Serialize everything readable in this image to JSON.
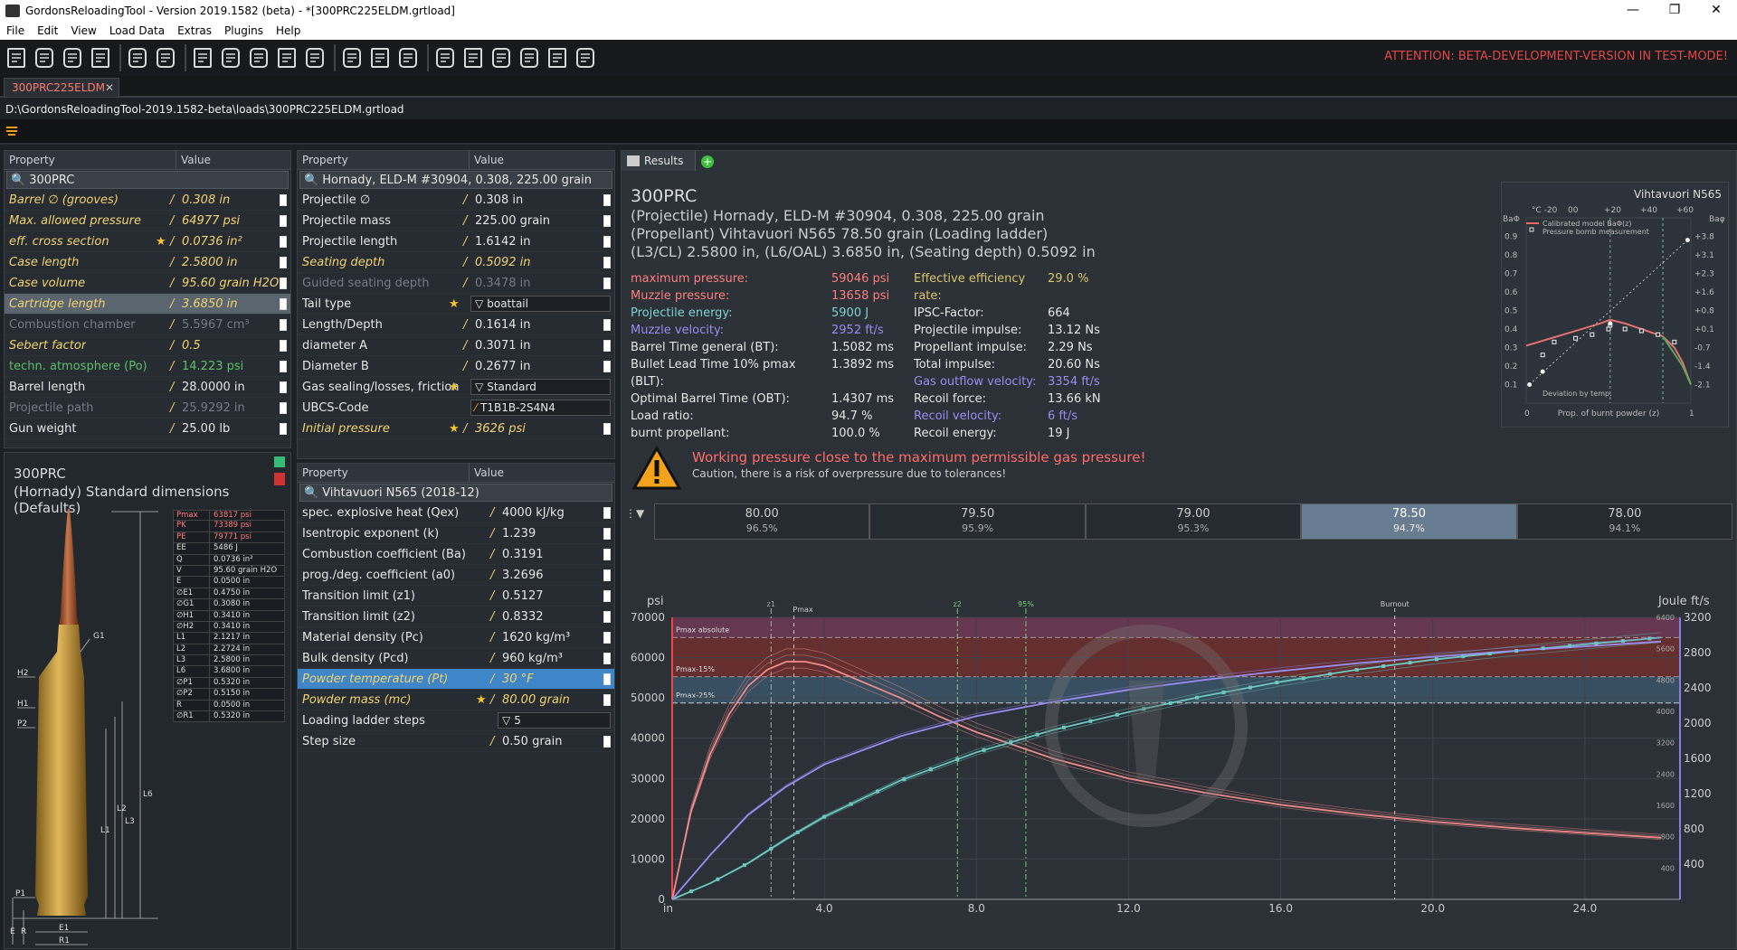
{
  "window": {
    "title": "GordonsReloadingTool - Version 2019.1582 (beta) - *[300PRC225ELDM.grtload]",
    "min": "—",
    "max": "❐",
    "close": "✕"
  },
  "menu": [
    "File",
    "Edit",
    "View",
    "Load Data",
    "Extras",
    "Plugins",
    "Help"
  ],
  "toolbar": {
    "attention": "ATTENTION: BETA-DEVELOPMENT-VERSION IN TEST-MODE!"
  },
  "tab": {
    "name": "300PRC225ELDM",
    "close": "✕"
  },
  "path": "D:\\GordonsReloadingTool-2019.1582-beta\\loads\\300PRC225ELDM.grtload",
  "colors": {
    "accent": "#f1d26e",
    "danger": "#ff6b6b",
    "selected": "#3f86c8"
  },
  "cartridge": {
    "header": [
      "Property",
      "Value"
    ],
    "title": "300PRC",
    "rows": [
      {
        "label": "Barrel ∅ (grooves)",
        "value": "0.308 in",
        "style": "it"
      },
      {
        "label": "Max. allowed pressure",
        "value": "64977 psi",
        "style": "it"
      },
      {
        "label": "eff. cross section",
        "value": "0.0736 in²",
        "style": "it",
        "star": true
      },
      {
        "label": "Case length",
        "value": "2.5800 in",
        "style": "it"
      },
      {
        "label": "Case volume",
        "value": "95.60 grain H2O",
        "style": "it"
      },
      {
        "label": "Cartridge length",
        "value": "3.6850 in",
        "style": "it",
        "sel": true
      },
      {
        "label": "Combustion chamber",
        "value": "5.5967 cm³",
        "style": "dim"
      },
      {
        "label": "Sebert factor",
        "value": "0.5",
        "style": "it"
      },
      {
        "label": "techn. atmosphere (Po)",
        "value": "14.223 psi",
        "style": "grn"
      },
      {
        "label": "Barrel length",
        "value": "28.0000 in",
        "style": ""
      },
      {
        "label": "Projectile path",
        "value": "25.9292 in",
        "style": "dim"
      },
      {
        "label": "Gun weight",
        "value": "25.00 lb",
        "style": ""
      }
    ]
  },
  "dims": {
    "title": "300PRC",
    "subtitle": "(Hornady) Standard dimensions (Defaults)",
    "table": [
      [
        "Pmax",
        "63817 psi"
      ],
      [
        "PK",
        "73389 psi"
      ],
      [
        "PE",
        "79771 psi"
      ],
      [
        "EE",
        "5486 J"
      ],
      [
        "Q",
        "0.0736 in²"
      ],
      [
        "V",
        "95.60 grain H2O"
      ],
      [
        "E",
        "0.0500 in"
      ],
      [
        "∅E1",
        "0.4750 in"
      ],
      [
        "∅G1",
        "0.3080 in"
      ],
      [
        "∅H1",
        "0.3410 in"
      ],
      [
        "∅H2",
        "0.3410 in"
      ],
      [
        "L1",
        "2.1217 in"
      ],
      [
        "L2",
        "2.2724 in"
      ],
      [
        "L3",
        "2.5800 in"
      ],
      [
        "L6",
        "3.6800 in"
      ],
      [
        "∅P1",
        "0.5320 in"
      ],
      [
        "∅P2",
        "0.5150 in"
      ],
      [
        "R",
        "0.0500 in"
      ],
      [
        "∅R1",
        "0.5320 in"
      ]
    ],
    "labels": {
      "g1": "G1",
      "h2": "H2",
      "h1": "H1",
      "p2": "P2",
      "p1": "P1",
      "l6": "L6",
      "l3": "L3",
      "l2": "L2",
      "l1": "L1",
      "e1": "E1",
      "r1": "R1",
      "e": "E",
      "r": "R"
    }
  },
  "projectile": {
    "header": [
      "Property",
      "Value"
    ],
    "title": "Hornady, ELD-M #30904, 0.308, 225.00 grain",
    "rows": [
      {
        "label": "Projectile ∅",
        "value": "0.308 in",
        "style": ""
      },
      {
        "label": "Projectile mass",
        "value": "225.00 grain",
        "style": ""
      },
      {
        "label": "Projectile length",
        "value": "1.6142 in",
        "style": ""
      },
      {
        "label": "Seating depth",
        "value": "0.5092 in",
        "style": "it"
      },
      {
        "label": "Guided seating depth",
        "value": "0.3478 in",
        "style": "dim"
      },
      {
        "label": "Tail type",
        "value": "boattail",
        "style": "",
        "dd": true,
        "star": true
      },
      {
        "label": "Length/Depth",
        "value": "0.1614 in",
        "style": ""
      },
      {
        "label": "diameter A",
        "value": "0.3071 in",
        "style": ""
      },
      {
        "label": "Diameter B",
        "value": "0.2677 in",
        "style": ""
      },
      {
        "label": "Gas sealing/losses, friction",
        "value": "Standard",
        "style": "",
        "dd": true,
        "star": true
      },
      {
        "label": "UBCS-Code",
        "value": "T1B1B-2S4N4",
        "style": "",
        "code": true
      },
      {
        "label": "Initial pressure",
        "value": "3626 psi",
        "style": "it",
        "star": true
      }
    ]
  },
  "propellant": {
    "header": [
      "Property",
      "Value"
    ],
    "title": "Vihtavuori N565 (2018-12)",
    "rows": [
      {
        "label": "spec. explosive heat (Qex)",
        "value": "4000 kJ/kg",
        "style": ""
      },
      {
        "label": "Isentropic exponent (k)",
        "value": "1.239",
        "style": ""
      },
      {
        "label": "Combustion coefficient (Ba)",
        "value": "0.3191",
        "style": ""
      },
      {
        "label": "prog./deg. coefficient (a0)",
        "value": "3.2696",
        "style": ""
      },
      {
        "label": "Transition limit (z1)",
        "value": "0.5127",
        "style": ""
      },
      {
        "label": "Transition limit (z2)",
        "value": "0.8332",
        "style": ""
      },
      {
        "label": "Material density (Pc)",
        "value": "1620 kg/m³",
        "style": ""
      },
      {
        "label": "Bulk density (Pcd)",
        "value": "960 kg/m³",
        "style": ""
      },
      {
        "label": "Powder temperature (Pt)",
        "value": "30 °F",
        "style": "it",
        "selblue": true
      },
      {
        "label": "Powder mass (mc)",
        "value": "80.00 grain",
        "style": "it",
        "star": true
      },
      {
        "label": "Loading ladder steps",
        "value": "5",
        "style": "",
        "dd": true
      },
      {
        "label": "Step size",
        "value": "0.50 grain",
        "style": ""
      }
    ]
  },
  "results": {
    "tab": "Results",
    "title": "300PRC",
    "lines": [
      "(Projectile) Hornady, ELD-M #30904, 0.308, 225.00 grain",
      "(Propellant) Vihtavuori N565 78.50 grain (Loading ladder)",
      "(L3/CL) 2.5800 in, (L6/OAL) 3.6850 in, (Seating depth) 0.5092 in"
    ],
    "left": [
      {
        "k": "maximum pressure:",
        "v": "59046 psi",
        "c": "#ff7e7e"
      },
      {
        "k": "Muzzle pressure:",
        "v": "13658 psi",
        "c": "#ff7e7e"
      },
      {
        "k": "Projectile energy:",
        "v": "5900 J",
        "c": "#7fd0d0"
      },
      {
        "k": "Muzzle velocity:",
        "v": "2952 ft/s",
        "c": "#9a8cf0"
      },
      {
        "k": "Barrel Time general (BT):",
        "v": "1.5082 ms",
        "c": ""
      },
      {
        "k": "Bullet Lead Time 10% pmax (BLT):",
        "v": "1.3892 ms",
        "c": ""
      },
      {
        "k": "Optimal Barrel Time (OBT):",
        "v": "1.4307 ms",
        "c": ""
      },
      {
        "k": "Load ratio:",
        "v": "94.7 %",
        "c": ""
      },
      {
        "k": "burnt propellant:",
        "v": "100.0 %",
        "c": ""
      }
    ],
    "right": [
      {
        "k": "Effective efficiency rate:",
        "v": "29.0 %",
        "c": "#d9c56a"
      },
      {
        "k": "IPSC-Factor:",
        "v": "664",
        "c": ""
      },
      {
        "k": "Projectile impulse:",
        "v": "13.12 Ns",
        "c": ""
      },
      {
        "k": "Propellant impulse:",
        "v": "2.29 Ns",
        "c": ""
      },
      {
        "k": "Total impulse:",
        "v": "20.60 Ns",
        "c": ""
      },
      {
        "k": "Gas outflow velocity:",
        "v": "3354 ft/s",
        "c": "#9a8cf0"
      },
      {
        "k": "Recoil force:",
        "v": "13.66 kN",
        "c": ""
      },
      {
        "k": "Recoil velocity:",
        "v": "6 ft/s",
        "c": "#9a8cf0"
      },
      {
        "k": "Recoil energy:",
        "v": "19 J",
        "c": ""
      }
    ],
    "warning": {
      "title": "Working pressure close to the maximum permissible gas pressure!",
      "text": "Caution, there is a risk of overpressure due to tolerances!"
    },
    "ladder": [
      {
        "grain": "80.00",
        "pct": "96.5%"
      },
      {
        "grain": "79.50",
        "pct": "95.9%"
      },
      {
        "grain": "79.00",
        "pct": "95.3%"
      },
      {
        "grain": "78.50",
        "pct": "94.7%",
        "active": true
      },
      {
        "grain": "78.00",
        "pct": "94.1%"
      }
    ]
  },
  "chart_data": [
    {
      "type": "line",
      "title": "Vihtavuori N565",
      "xlabel": "Prop. of burnt powder (z)",
      "ylabel": "BaΦ",
      "x_ticks": [
        "0",
        "1"
      ],
      "top_ticks": [
        "°C -20",
        "00",
        "+20",
        "+40",
        "+60"
      ],
      "y_ticks": [
        "0.1",
        "0.2",
        "0.3",
        "0.4",
        "0.5",
        "0.6",
        "0.7",
        "0.8",
        "0.9"
      ],
      "y2_ticks": [
        "-2.1",
        "-1.4",
        "-0.7",
        "+0.1",
        "+0.8",
        "+1.6",
        "+2.3",
        "+3.1",
        "+3.8"
      ],
      "y2label": "Baφ",
      "legend": [
        "Calibrated model BaΦ(z)",
        "Pressure bomb measurement"
      ],
      "legend_bottom": "Deviation by temp.",
      "series": [
        {
          "name": "Calibrated model BaΦ(z)",
          "x": [
            0,
            0.15,
            0.3,
            0.45,
            0.51,
            0.6,
            0.7,
            0.83,
            0.9,
            0.95,
            1.0
          ],
          "y": [
            0.31,
            0.35,
            0.39,
            0.43,
            0.45,
            0.43,
            0.4,
            0.36,
            0.3,
            0.22,
            0.1
          ]
        },
        {
          "name": "Pressure bomb measurement",
          "x": [
            0.1,
            0.17,
            0.3,
            0.4,
            0.5,
            0.51,
            0.6,
            0.7,
            0.8,
            0.9
          ],
          "y": [
            0.26,
            0.33,
            0.35,
            0.37,
            0.4,
            0.42,
            0.4,
            0.39,
            0.37,
            0.33
          ]
        }
      ]
    },
    {
      "type": "line",
      "title": "",
      "x_unit": "in",
      "y_unit": "psi",
      "y2_unit": "Joule",
      "y3_unit": "ft/s",
      "x_ticks": [
        "4.0",
        "8.0",
        "12.0",
        "16.0",
        "20.0",
        "24.0"
      ],
      "xlim": [
        0,
        26.5
      ],
      "ylim": [
        0,
        70000
      ],
      "y_ticks": [
        "0",
        "10000",
        "20000",
        "30000",
        "40000",
        "50000",
        "60000",
        "70000"
      ],
      "y2_ticks": [
        "400",
        "800",
        "1200",
        "1600",
        "2000",
        "2400",
        "2800",
        "3200"
      ],
      "y3_ticks": [
        "400",
        "800",
        "1200",
        "1600",
        "2000",
        "2400",
        "2800",
        "3200"
      ],
      "joule_ticks": [
        "400",
        "800",
        "1600",
        "2400",
        "3200",
        "4000",
        "4800",
        "5600",
        "6400"
      ],
      "bands": [
        {
          "name": "Pmax absolute",
          "from": 64977,
          "to": 70000
        },
        {
          "name": "Pmax-15%",
          "from": 55230,
          "to": 64977
        },
        {
          "name": "Pmax-25%",
          "from": 48733,
          "to": 55230
        }
      ],
      "markers": [
        {
          "name": "z1",
          "x": 2.6
        },
        {
          "name": "Pmax",
          "x": 3.2
        },
        {
          "name": "z2",
          "x": 7.5
        },
        {
          "name": "95%",
          "x": 9.3
        },
        {
          "name": "Burnout",
          "x": 19.0
        }
      ],
      "series": [
        {
          "name": "pressure",
          "x": [
            0,
            0.5,
            1,
            1.5,
            2,
            2.5,
            3,
            3.5,
            4,
            5,
            6,
            7,
            8,
            10,
            12,
            14,
            16,
            18,
            20,
            22,
            24,
            26
          ],
          "y": [
            0,
            22000,
            36000,
            46000,
            53000,
            57000,
            59000,
            59000,
            58000,
            54000,
            50000,
            45500,
            41500,
            35000,
            30000,
            26500,
            23500,
            21200,
            19300,
            17800,
            16500,
            15300
          ]
        },
        {
          "name": "energy",
          "x": [
            0,
            1,
            2,
            3,
            4,
            6,
            8,
            10,
            12,
            14,
            16,
            18,
            20,
            22,
            24,
            26
          ],
          "y": [
            0,
            4000,
            9000,
            15000,
            20500,
            29500,
            36500,
            42000,
            46500,
            50500,
            54000,
            57000,
            59500,
            61500,
            63300,
            65000
          ]
        },
        {
          "name": "velocity",
          "x": [
            0,
            1,
            2,
            3,
            4,
            6,
            8,
            10,
            12,
            14,
            16,
            18,
            20,
            22,
            24,
            26
          ],
          "y": [
            0,
            11000,
            21000,
            28000,
            33500,
            40500,
            45500,
            49000,
            52000,
            54500,
            56700,
            58600,
            60200,
            61600,
            62800,
            64000
          ]
        }
      ]
    }
  ]
}
